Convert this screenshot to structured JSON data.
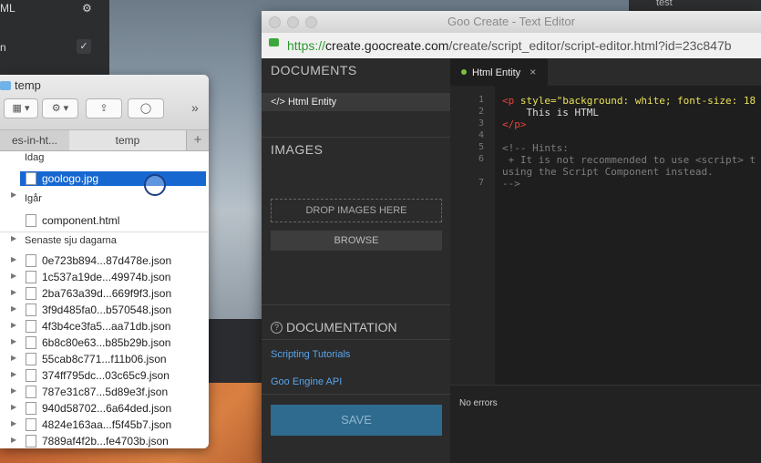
{
  "left_panel": {
    "label_top": "ML",
    "label_mid": "n"
  },
  "top_right": {
    "label": "test"
  },
  "finder": {
    "title": "temp",
    "tabs": [
      "es-in-ht...",
      "temp"
    ],
    "more_label": "»",
    "sections": {
      "today": "Idag",
      "yesterday": "Igår",
      "last_week": "Senaste sju dagarna"
    },
    "today_files": [
      "goologo.jpg"
    ],
    "yesterday_files": [
      "component.html"
    ],
    "week_files": [
      "0e723b894...87d478e.json",
      "1c537a19de...49974b.json",
      "2ba763a39d...669f9f3.json",
      "3f9d485fa0...b570548.json",
      "4f3b4ce3fa5...aa71db.json",
      "6b8c80e63...b85b29b.json",
      "55cab8c771...f11b06.json",
      "374ff795dc...03c65c9.json",
      "787e31c87...5d89e3f.json",
      "940d58702...6a64ded.json",
      "4824e163aa...f5f45b7.json",
      "7889af4f2b...fe4703b.json"
    ]
  },
  "browser": {
    "window_title": "Goo Create - Text Editor",
    "url_scheme": "https://",
    "url_host": "create.goocreate.com",
    "url_path": "/create/script_editor/script-editor.html?id=23c847b"
  },
  "sidebar": {
    "documents_heading": "DOCUMENTS",
    "document_item": "</> Html Entity",
    "images_heading": "IMAGES",
    "drop_label": "DROP IMAGES HERE",
    "browse_label": "BROWSE",
    "documentation_heading": "DOCUMENTATION",
    "links": [
      "Scripting Tutorials",
      "Goo Engine API"
    ],
    "save_label": "SAVE"
  },
  "editor": {
    "tab_label": "Html Entity",
    "line_numbers": [
      "1",
      "2",
      "3",
      "4",
      "5",
      "6",
      "",
      "7"
    ],
    "code": {
      "l1_tag": "<p ",
      "l1_attr": "style=\"background: white; font-size: 18",
      "l2_text": "    This is HTML",
      "l3_tag": "</p>",
      "l5": "<!-- Hints:",
      "l6a": " + It is not recommended to use <script> t",
      "l6b": "using the Script Component instead.",
      "l7": "-->"
    },
    "status": "No errors"
  },
  "colors": {
    "accent_blue": "#1767d1",
    "save_button": "#2f6a8f",
    "link": "#5aa4ea",
    "url_green": "#2c9a2c"
  }
}
